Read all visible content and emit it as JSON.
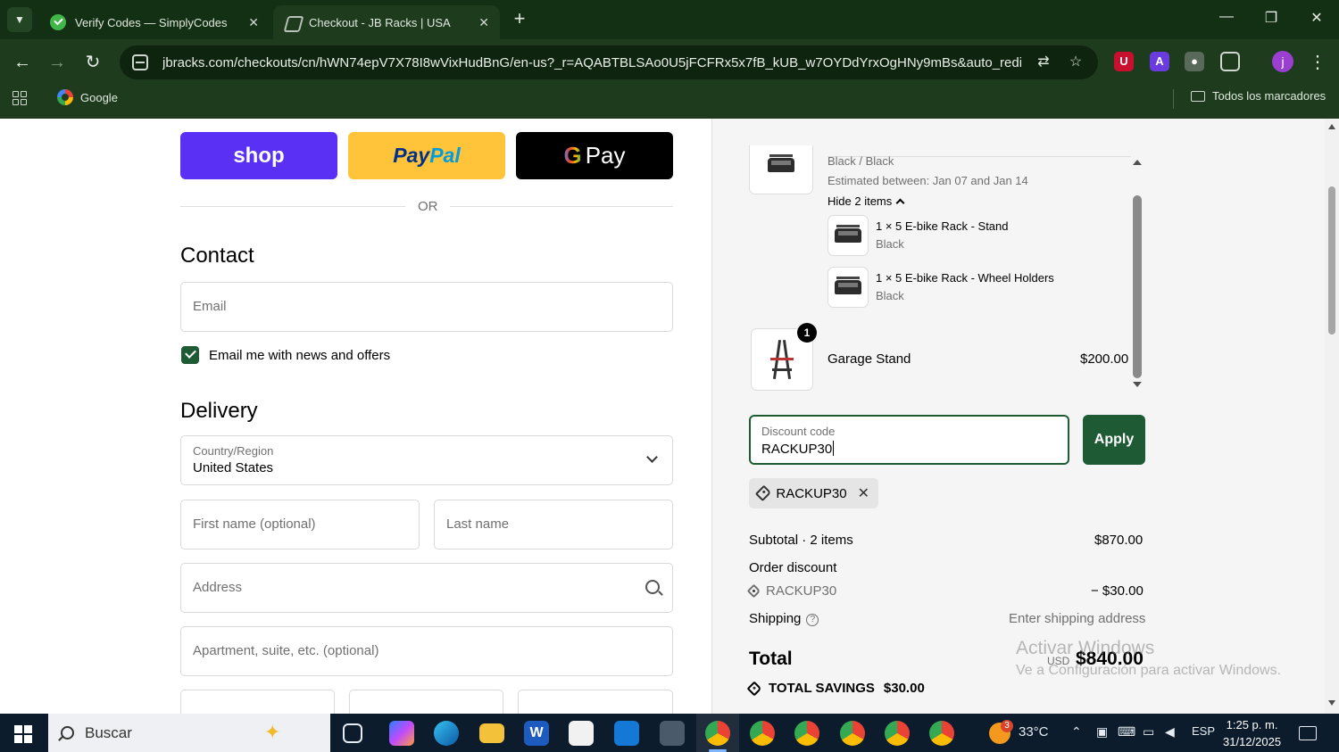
{
  "browser": {
    "tabs": [
      {
        "title": "Verify Codes — SimplyCodes",
        "icon": "simplycodes-icon"
      },
      {
        "title": "Checkout - JB Racks | USA",
        "icon": "jbracks-icon"
      }
    ],
    "url": "jbracks.com/checkouts/cn/hWN74epV7X78I8wVixHudBnG/en-us?_r=AQABTBLSAo0U5jFCFRx5x7fB_kUB_w7OYDdYrxOgHNy9mBs&auto_redire...",
    "avatar_letter": "j",
    "bookmarks": {
      "google": "Google",
      "all_bookmarks": "Todos los marcadores"
    }
  },
  "express": {
    "shop_label": "shop",
    "paypal_pay": "Pay",
    "paypal_pal": "Pal",
    "gpay_label": "Pay",
    "or": "OR"
  },
  "contact": {
    "heading": "Contact",
    "email_placeholder": "Email",
    "newsletter_label": "Email me with news and offers",
    "newsletter_checked": true
  },
  "delivery": {
    "heading": "Delivery",
    "country_label": "Country/Region",
    "country_value": "United States",
    "first_name_placeholder": "First name (optional)",
    "last_name_placeholder": "Last name",
    "address_placeholder": "Address",
    "apartment_placeholder": "Apartment, suite, etc. (optional)"
  },
  "order": {
    "variant": "Black / Black",
    "estimate": "Estimated between: Jan 07 and Jan 14",
    "hide_items": "Hide 2 items",
    "sub_items": [
      {
        "name": "1 × 5 E-bike Rack - Stand",
        "variant": "Black"
      },
      {
        "name": "1 × 5 E-bike Rack - Wheel Holders",
        "variant": "Black"
      }
    ],
    "garage": {
      "qty": "1",
      "name": "Garage Stand",
      "price": "$200.00"
    }
  },
  "discount": {
    "label": "Discount code",
    "value": "RACKUP30",
    "apply": "Apply",
    "applied_code": "RACKUP30"
  },
  "summary": {
    "subtotal_label": "Subtotal · 2 items",
    "subtotal_value": "$870.00",
    "order_discount_label": "Order discount",
    "discount_code": "RACKUP30",
    "discount_value": "− $30.00",
    "shipping_label": "Shipping",
    "shipping_value": "Enter shipping address",
    "total_label": "Total",
    "currency": "USD",
    "total_value": "$840.00",
    "savings_label": "TOTAL SAVINGS",
    "savings_value": "$30.00"
  },
  "watermark": {
    "line1": "Activar Windows",
    "line2": "Ve a Configuración para activar Windows."
  },
  "taskbar": {
    "search_label": "Buscar",
    "weather_badge": "3",
    "temperature": "33°C",
    "language": "ESP",
    "time": "1:25 p. m.",
    "date": "31/12/2025"
  }
}
